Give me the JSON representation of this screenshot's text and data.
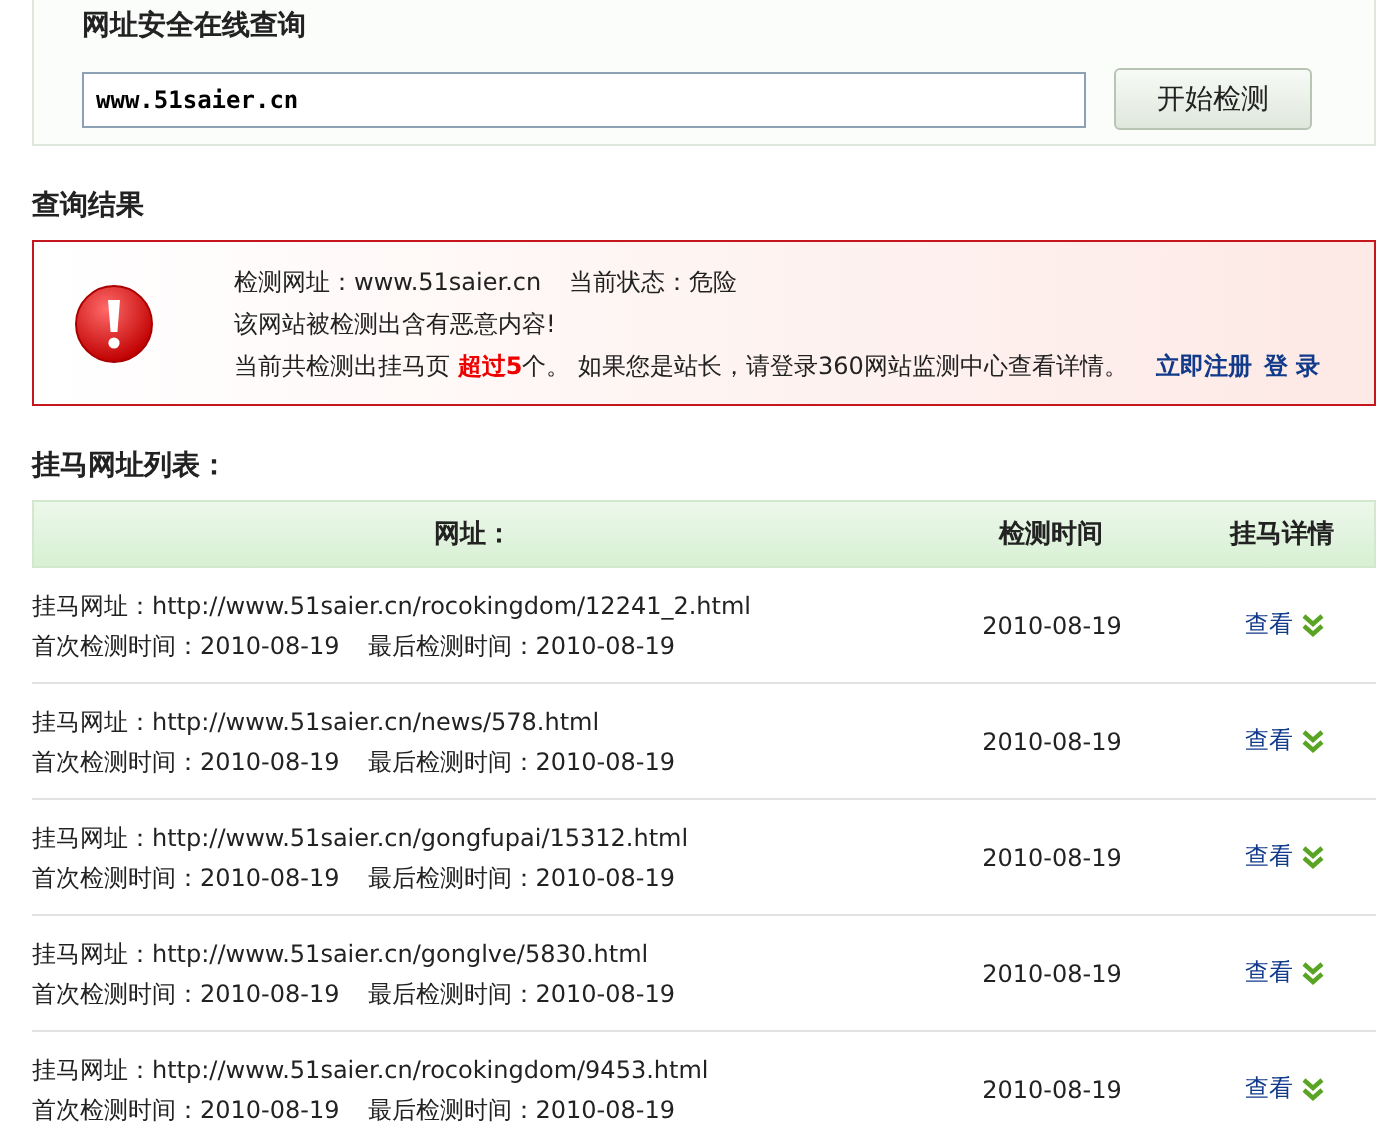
{
  "query_panel": {
    "title": "网址安全在线查询",
    "url_field": {
      "value": "www.51saier.cn"
    },
    "button": "开始检测"
  },
  "result_title": "查询结果",
  "alert": {
    "kind": "danger",
    "line_1": [
      {
        "text": "检测网址：www.51saier.cn"
      },
      {
        "text": "当前状态：危险"
      }
    ],
    "line_2": "该网站被检测出含有恶意内容!",
    "line_3": [
      {
        "text": "当前共检测出挂马页 ",
        "highlight": false
      },
      {
        "text": "超过5",
        "highlight": true
      },
      {
        "text": "个。 如果您是站长，请登录360网站监测中心查看详情。",
        "highlight": false
      }
    ],
    "links": [
      "立即注册",
      "登 录"
    ]
  },
  "list_title": "挂马网址列表：",
  "table": {
    "columns": [
      "网址：",
      "检测时间",
      "挂马详情"
    ],
    "rows": [
      {
        "url": "挂马网址：http://www.51saier.cn/rocokingdom/12241_2.html",
        "first": "首次检测时间：2010-08-19",
        "last": "最后检测时间：2010-08-19",
        "time": "2010-08-19",
        "action": "查看"
      },
      {
        "url": "挂马网址：http://www.51saier.cn/news/578.html",
        "first": "首次检测时间：2010-08-19",
        "last": "最后检测时间：2010-08-19",
        "time": "2010-08-19",
        "action": "查看"
      },
      {
        "url": "挂马网址：http://www.51saier.cn/gongfupai/15312.html",
        "first": "首次检测时间：2010-08-19",
        "last": "最后检测时间：2010-08-19",
        "time": "2010-08-19",
        "action": "查看"
      },
      {
        "url": "挂马网址：http://www.51saier.cn/gonglve/5830.html",
        "first": "首次检测时间：2010-08-19",
        "last": "最后检测时间：2010-08-19",
        "time": "2010-08-19",
        "action": "查看"
      },
      {
        "url": "挂马网址：http://www.51saier.cn/rocokingdom/9453.html",
        "first": "首次检测时间：2010-08-19",
        "last": "最后检测时间：2010-08-19",
        "time": "2010-08-19",
        "action": "查看"
      }
    ]
  }
}
